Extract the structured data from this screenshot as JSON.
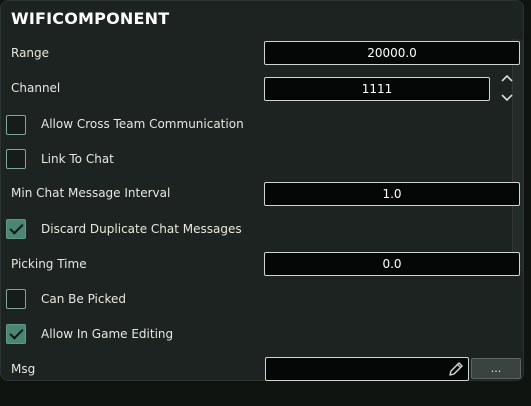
{
  "title": "WIFICOMPONENT",
  "fields": {
    "range": {
      "label": "Range",
      "value": "20000.0"
    },
    "channel": {
      "label": "Channel",
      "value": "1111"
    },
    "min_chat_interval": {
      "label": "Min Chat Message Interval",
      "value": "1.0"
    },
    "picking_time": {
      "label": "Picking Time",
      "value": "0.0"
    },
    "msg": {
      "label": "Msg",
      "value": "",
      "button_label": "..."
    }
  },
  "checkboxes": {
    "cross_team": {
      "label": "Allow Cross Team Communication",
      "checked": false
    },
    "link_to_chat": {
      "label": "Link To Chat",
      "checked": false
    },
    "discard_duplicate": {
      "label": "Discard Duplicate Chat Messages",
      "checked": true
    },
    "can_be_picked": {
      "label": "Can Be Picked",
      "checked": false
    },
    "allow_in_game_editing": {
      "label": "Allow In Game Editing",
      "checked": true
    }
  },
  "icons": {
    "stepper_up": "chevron-up-icon",
    "stepper_down": "chevron-down-icon",
    "checkmark": "check-icon",
    "edit": "pencil-icon"
  },
  "colors": {
    "panel_bg": "#1c2320",
    "accent_checked": "#4b8674",
    "field_bg": "#050707"
  }
}
